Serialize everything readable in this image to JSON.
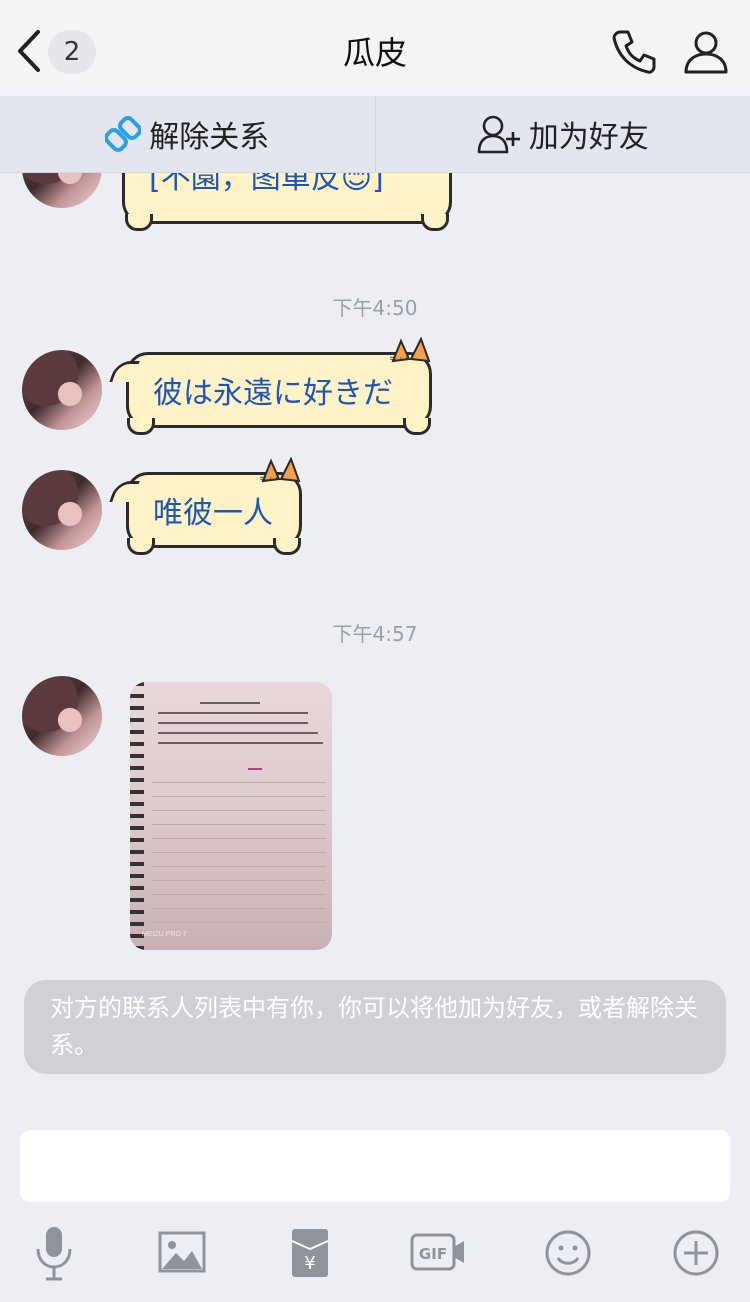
{
  "header": {
    "back_count": "2",
    "title": "瓜皮"
  },
  "actions": {
    "unbind_label": "解除关系",
    "add_friend_label": "加为好友"
  },
  "messages": [
    {
      "type": "text",
      "text": "[不園，图單反😊]"
    },
    {
      "type": "time",
      "text": "下午4:50"
    },
    {
      "type": "text",
      "text": "彼は永遠に好きだ"
    },
    {
      "type": "text",
      "text": "唯彼一人"
    },
    {
      "type": "time",
      "text": "下午4:57"
    },
    {
      "type": "image",
      "watermark": "MEIZU PRO 7"
    }
  ],
  "notice": "对方的联系人列表中有你，你可以将他加为好友，或者解除关系。",
  "input": {
    "value": ""
  },
  "toolbar": [
    "microphone-icon",
    "image-icon",
    "red-packet-icon",
    "gif-icon",
    "emoji-icon",
    "plus-icon"
  ],
  "colors": {
    "bubble_fill": "#fdf3c7",
    "bubble_text": "#1d56b7",
    "link_accent": "#2aa0e6"
  }
}
